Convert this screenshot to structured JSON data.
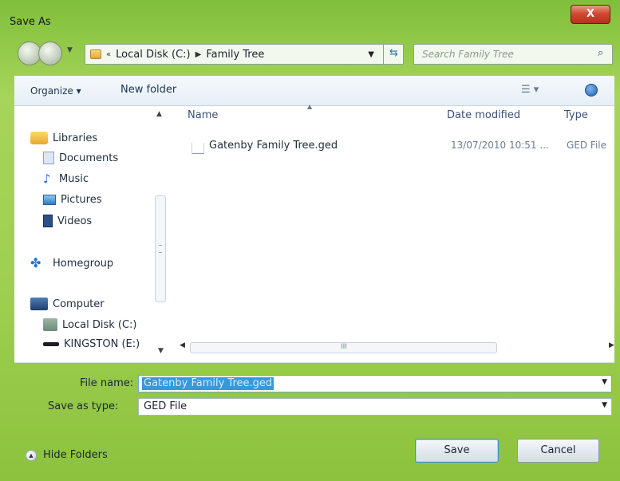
{
  "window": {
    "title": "Save As",
    "close_label": "X"
  },
  "address": {
    "breadcrumb_root": "Local Disk (C:)",
    "breadcrumb_current": "Family Tree",
    "search_placeholder": "Search Family Tree"
  },
  "toolbar": {
    "organize_label": "Organize ▾",
    "new_folder_label": "New folder"
  },
  "nav": {
    "items": [
      {
        "label": "Libraries",
        "icon": "libraries-icon"
      },
      {
        "label": "Documents",
        "icon": "documents-icon"
      },
      {
        "label": "Music",
        "icon": "music-icon"
      },
      {
        "label": "Pictures",
        "icon": "pictures-icon"
      },
      {
        "label": "Videos",
        "icon": "videos-icon"
      },
      {
        "label": "Homegroup",
        "icon": "homegroup-icon"
      },
      {
        "label": "Computer",
        "icon": "computer-icon"
      },
      {
        "label": "Local Disk (C:)",
        "icon": "drive-icon"
      },
      {
        "label": "KINGSTON (E:)",
        "icon": "usb-drive-icon"
      }
    ]
  },
  "files": {
    "columns": [
      "Name",
      "Date modified",
      "Type"
    ],
    "rows": [
      {
        "name": "Gatenby Family Tree.ged",
        "date_modified": "13/07/2010 10:51 ...",
        "type": "GED File"
      }
    ],
    "h_scroll_grip": "III"
  },
  "form": {
    "file_name_label": "File name:",
    "file_name_value": "Gatenby Family Tree.ged",
    "save_as_type_label": "Save as type:",
    "save_as_type_value": "GED File"
  },
  "footer": {
    "hide_folders_label": "Hide Folders",
    "save_label": "Save",
    "cancel_label": "Cancel"
  },
  "colors": {
    "accent": "#3399e0",
    "close": "#d24a33",
    "link": "#1d3555"
  }
}
